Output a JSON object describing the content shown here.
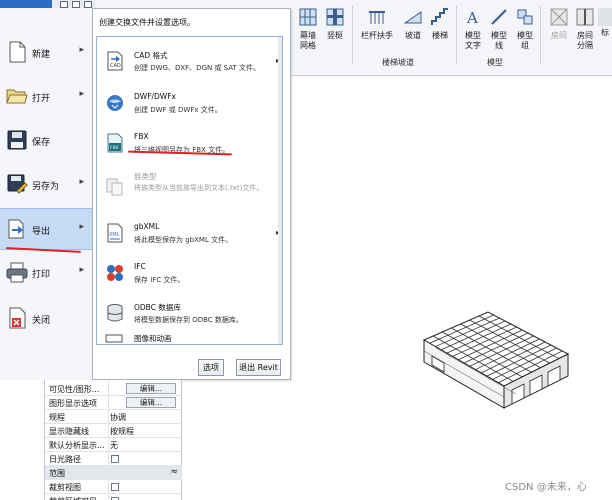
{
  "ribbon": {
    "tools": [
      {
        "label": "幕墙\n网格"
      },
      {
        "label": "竖梃"
      },
      {
        "label": "栏杆扶手"
      },
      {
        "label": "坡道"
      },
      {
        "label": "楼梯"
      },
      {
        "label": "模型\n文字"
      },
      {
        "label": "模型\n线"
      },
      {
        "label": "模型\n组"
      },
      {
        "label": "房间"
      },
      {
        "label": "房间\n分隔"
      },
      {
        "label": "标"
      }
    ],
    "groups": {
      "stairs_ramps": "楼梯坡道",
      "model": "模型"
    }
  },
  "appmenu": {
    "items": [
      {
        "label": "新建"
      },
      {
        "label": "打开"
      },
      {
        "label": "保存"
      },
      {
        "label": "另存为"
      },
      {
        "label": "导出"
      },
      {
        "label": "打印"
      },
      {
        "label": "关闭"
      }
    ]
  },
  "export_menu": {
    "title": "创建交换文件并设置选项。",
    "options": [
      {
        "title": "CAD 格式",
        "desc": "创建 DWG、DXF、DGN 或 SAT 文件。",
        "icon": "cad-icon",
        "has_submenu": true
      },
      {
        "title": "DWF/DWFx",
        "desc": "创建 DWF 或 DWFx 文件。",
        "icon": "dwf-icon"
      },
      {
        "title": "FBX",
        "desc": "将三维视图另存为 FBX 文件。",
        "icon": "fbx-icon"
      },
      {
        "title": "族类型",
        "desc": "将族类型从当前族导出到文本(.txt)文件。",
        "icon": "family-types-icon",
        "disabled": true
      },
      {
        "title": "gbXML",
        "desc": "将此模型保存为 gbXML 文件。",
        "icon": "gbxml-icon",
        "has_submenu": true
      },
      {
        "title": "IFC",
        "desc": "保存 IFC 文件。",
        "icon": "ifc-icon"
      },
      {
        "title": "ODBC 数据库",
        "desc": "将模型数据保存到 ODBC 数据库。",
        "icon": "database-icon"
      },
      {
        "title": "图像和动画",
        "desc": "",
        "icon": "image-icon"
      }
    ],
    "options_button": "选项",
    "exit_button": "退出 Revit"
  },
  "properties": {
    "rows": [
      {
        "key": "可见性/图形...",
        "value": "编辑...",
        "kind": "button"
      },
      {
        "key": "图形显示选项",
        "value": "编辑...",
        "kind": "button"
      },
      {
        "key": "规程",
        "value": "协调",
        "kind": "text"
      },
      {
        "key": "显示隐藏线",
        "value": "按规程",
        "kind": "text"
      },
      {
        "key": "默认分析显示...",
        "value": "无",
        "kind": "text"
      },
      {
        "key": "日光路径",
        "value": "",
        "kind": "checkbox"
      },
      {
        "key": "范围",
        "value": "",
        "kind": "section"
      },
      {
        "key": "裁剪视图",
        "value": "",
        "kind": "checkbox"
      },
      {
        "key": "裁剪区域可见",
        "value": "",
        "kind": "checkbox"
      }
    ],
    "collapse_glyph": "≈"
  },
  "watermark": "CSDN @未来，心",
  "colors": {
    "accent": "#2b6cc4",
    "active_menu": "#c6dcf5",
    "annotation": "#e0202a"
  }
}
